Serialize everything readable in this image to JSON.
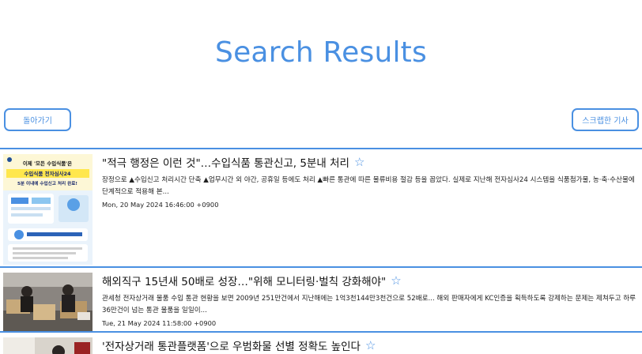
{
  "header": {
    "title": "Search Results"
  },
  "toolbar": {
    "back_label": "돌아가기",
    "scrap_label": "스크랩한 기사"
  },
  "results": [
    {
      "title": "\"적극 행정은 이런 것\"…수입식품 통관신고, 5분내 처리",
      "star": "☆",
      "snippet": "장정으로 ▲수입신고 처리시간 단축 ▲업무시간 외 야간, 공휴일 등에도 처리 ▲빠른 통관에 따른 물류비용 절감 등을 꼽았다. 실제로 지난해 전자심사24 시스템을 식품첨가물, 농·축·수산물에 단계적으로 적용해 본...",
      "date": "Mon, 20 May 2024 16:46:00 +0900",
      "thumb": {
        "text_line1": "이제 '모든 수입식품'은",
        "text_line2": "수입식품 전자심사24",
        "text_line3": "5분 이내에 수입신고 처리 완료!"
      }
    },
    {
      "title": "해외직구 15년새 50배로 성장…\"위해 모니터링·벌칙 강화해야\"",
      "star": "☆",
      "snippet": "관세청 전자상거래 물품 수입 통관 현황을 보면 2009년 251만건에서 지난해에는 1억3천144만3천건으로 52배로... 해외 판매자에게 KC인증을 획득하도록 강제하는 문제는 제쳐두고 하루 36만건이 넘는 통관 물품을 일일이...",
      "date": "Tue, 21 May 2024 11:58:00 +0900"
    },
    {
      "title": "'전자상거래 통관플랫폼'으로 우범화물 선별 정확도 높인다",
      "star": "☆"
    }
  ]
}
